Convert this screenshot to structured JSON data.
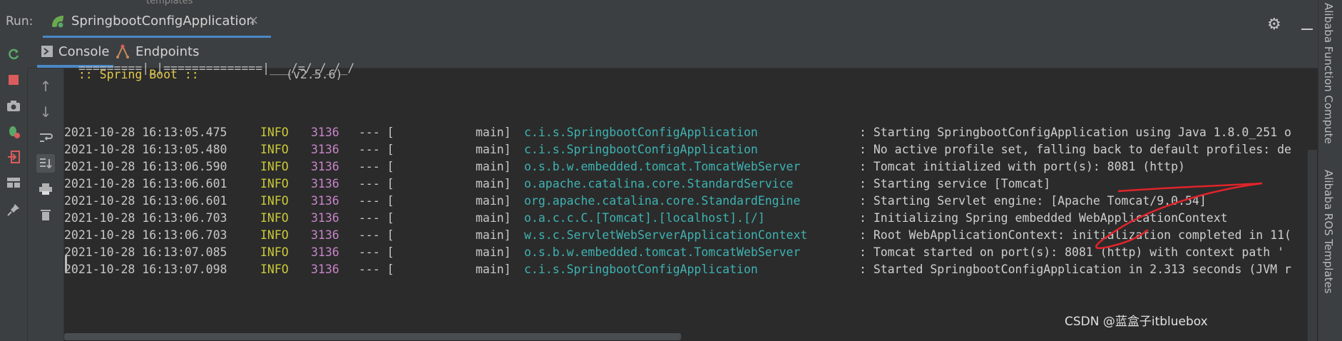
{
  "top_strip": {
    "crumb": "templates"
  },
  "run": {
    "label": "Run:",
    "tab": {
      "name": "SpringbootConfigApplication",
      "close": "×"
    }
  },
  "subtabs": [
    {
      "label": "Console",
      "icon": "console-icon",
      "active": true
    },
    {
      "label": "Endpoints",
      "icon": "endpoints-icon",
      "active": false
    }
  ],
  "left_toolbar_icons": [
    "rerun-icon",
    "stop-icon",
    "camera-icon",
    "debug-icon",
    "exit-icon",
    "layout-icon",
    "pin-icon"
  ],
  "console_toolbar_icons": [
    "arrow-up-icon",
    "arrow-down-icon",
    "soft-wrap-icon",
    "scroll-to-end-icon",
    "print-icon",
    "trash-icon"
  ],
  "console": {
    "banner_line": "  =========|_|==============|___/=/_/_/_/",
    "spring_boot": "  :: Spring Boot ::",
    "version": "(v2.5.6)",
    "logs": [
      {
        "ts": "2021-10-28 16:13:05.475",
        "level": "INFO",
        "pid": "3136",
        "sep": "--- [",
        "thread": "main]",
        "logger": "c.i.s.SpringbootConfigApplication",
        "msg": ": Starting SpringbootConfigApplication using Java 1.8.0_251 o"
      },
      {
        "ts": "2021-10-28 16:13:05.480",
        "level": "INFO",
        "pid": "3136",
        "sep": "--- [",
        "thread": "main]",
        "logger": "c.i.s.SpringbootConfigApplication",
        "msg": ": No active profile set, falling back to default profiles: de"
      },
      {
        "ts": "2021-10-28 16:13:06.590",
        "level": "INFO",
        "pid": "3136",
        "sep": "--- [",
        "thread": "main]",
        "logger": "o.s.b.w.embedded.tomcat.TomcatWebServer",
        "msg": ": Tomcat initialized with port(s): 8081 (http)"
      },
      {
        "ts": "2021-10-28 16:13:06.601",
        "level": "INFO",
        "pid": "3136",
        "sep": "--- [",
        "thread": "main]",
        "logger": "o.apache.catalina.core.StandardService",
        "msg": ": Starting service [Tomcat]"
      },
      {
        "ts": "2021-10-28 16:13:06.601",
        "level": "INFO",
        "pid": "3136",
        "sep": "--- [",
        "thread": "main]",
        "logger": "org.apache.catalina.core.StandardEngine",
        "msg": ": Starting Servlet engine: [Apache Tomcat/9.0.54]"
      },
      {
        "ts": "2021-10-28 16:13:06.703",
        "level": "INFO",
        "pid": "3136",
        "sep": "--- [",
        "thread": "main]",
        "logger": "o.a.c.c.C.[Tomcat].[localhost].[/]",
        "msg": ": Initializing Spring embedded WebApplicationContext"
      },
      {
        "ts": "2021-10-28 16:13:06.703",
        "level": "INFO",
        "pid": "3136",
        "sep": "--- [",
        "thread": "main]",
        "logger": "w.s.c.ServletWebServerApplicationContext",
        "msg": ": Root WebApplicationContext: initialization completed in 11("
      },
      {
        "ts": "2021-10-28 16:13:07.085",
        "level": "INFO",
        "pid": "3136",
        "sep": "--- [",
        "thread": "main]",
        "logger": "o.s.b.w.embedded.tomcat.TomcatWebServer",
        "msg": ": Tomcat started on port(s): 8081 (http) with context path '"
      },
      {
        "ts": "2021-10-28 16:13:07.098",
        "level": "INFO",
        "pid": "3136",
        "sep": "--- [",
        "thread": "main]",
        "logger": "c.i.s.SpringbootConfigApplication",
        "msg": ": Started SpringbootConfigApplication in 2.313 seconds (JVM r"
      }
    ]
  },
  "right_panel": {
    "tool1": "Alibaba Function Compute",
    "tool2": "Alibaba ROS Templates"
  },
  "watermark": "CSDN @蓝盒子itbluebox",
  "colors": {
    "accent": "#4a88c7",
    "level": "#c9c93a",
    "pid": "#c785c8",
    "logger": "#3fb2b2",
    "spring_boot": "#e3c94a",
    "annotation": "#e0242b"
  }
}
